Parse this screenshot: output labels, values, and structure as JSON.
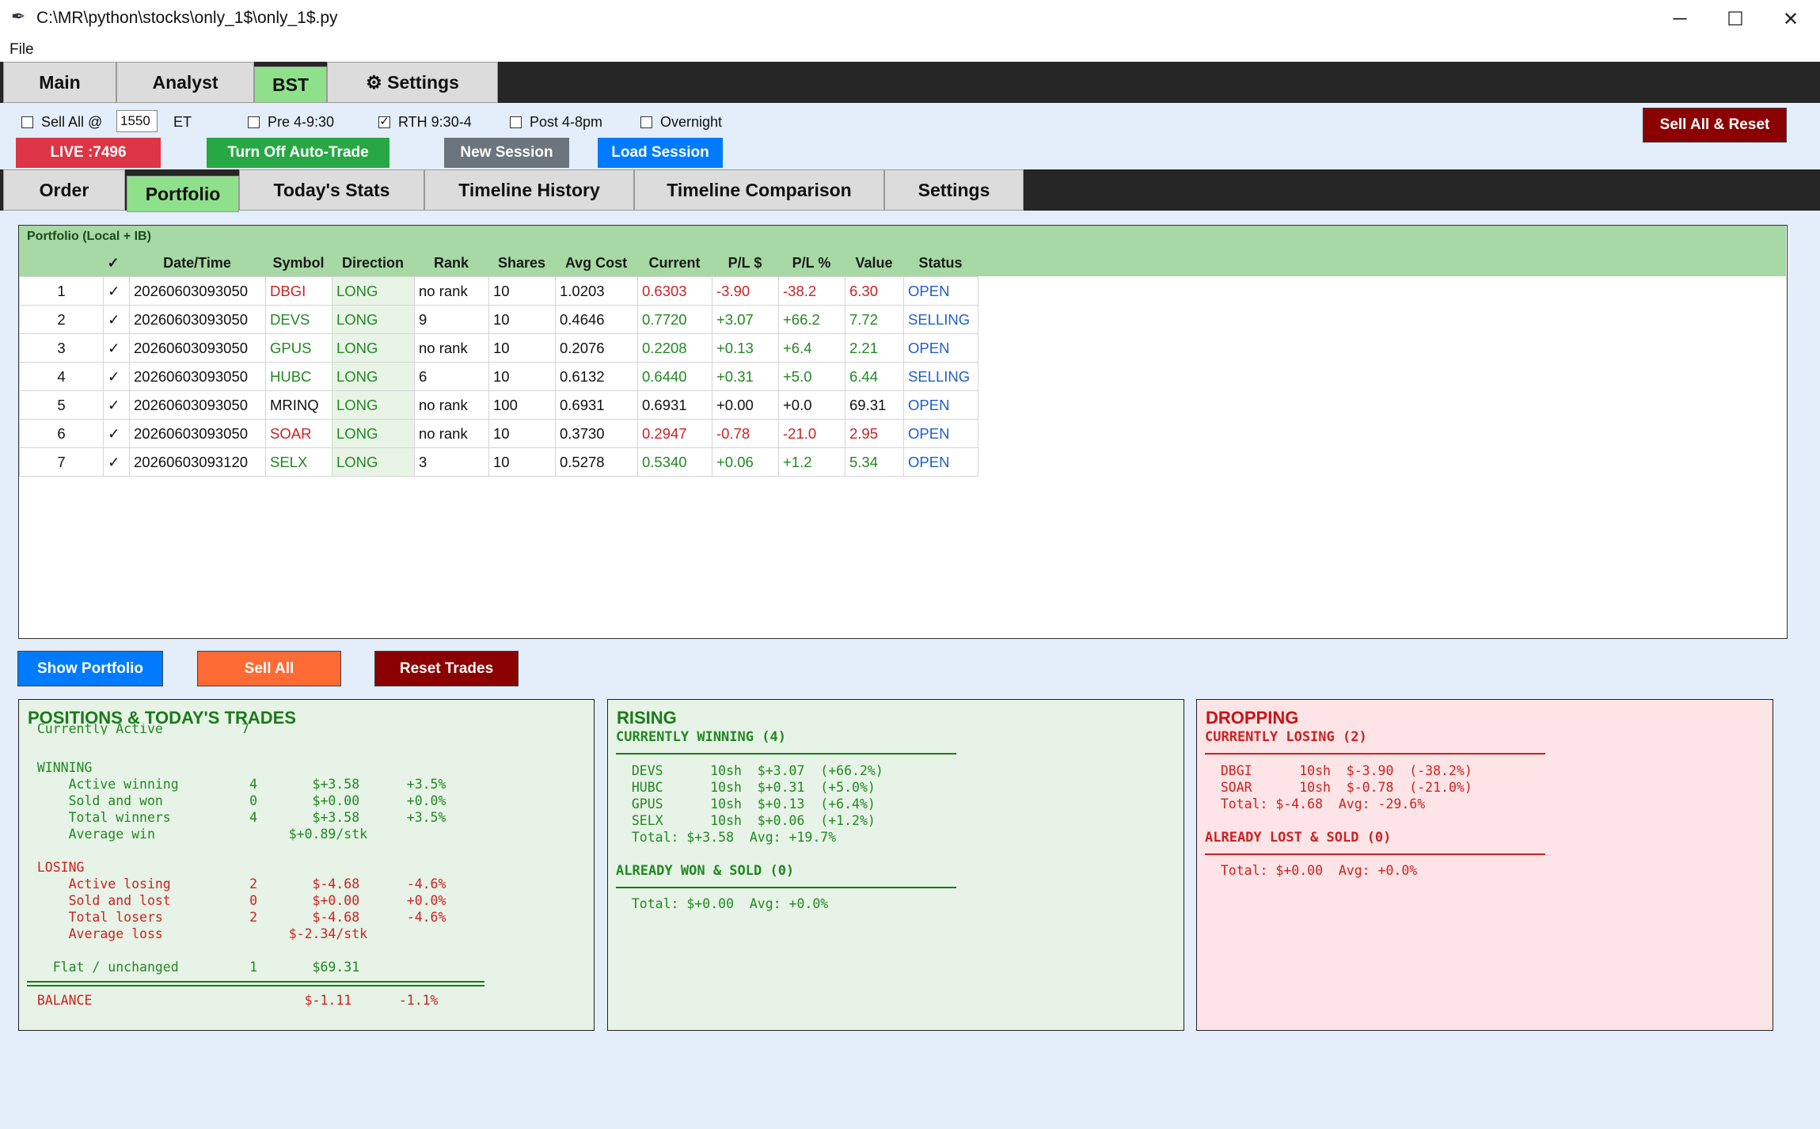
{
  "window": {
    "title": "C:\\MR\\python\\stocks\\only_1$\\only_1$.py"
  },
  "menu": {
    "file": "File"
  },
  "top_tabs": [
    {
      "label": "Main"
    },
    {
      "label": "Analyst"
    },
    {
      "label": "BST"
    },
    {
      "label": "⚙ Settings"
    }
  ],
  "controls": {
    "sell_all_label": "Sell All @",
    "sell_all_time": "1550",
    "sell_all_tz": "ET",
    "pre": "Pre 4-9:30",
    "rth": "RTH 9:30-4",
    "post": "Post 4-8pm",
    "overnight": "Overnight",
    "rth_checked": "✓",
    "live": "LIVE :7496",
    "autotrade": "Turn Off Auto-Trade",
    "new_session": "New Session",
    "load_session": "Load Session",
    "sell_all_reset": "Sell All & Reset"
  },
  "sub_tabs": [
    {
      "label": "Order"
    },
    {
      "label": "Portfolio"
    },
    {
      "label": "Today's Stats"
    },
    {
      "label": "Timeline History"
    },
    {
      "label": "Timeline Comparison"
    },
    {
      "label": "Settings"
    }
  ],
  "portfolio": {
    "caption": "Portfolio (Local + IB)",
    "headers": [
      "✓",
      "Date/Time",
      "Symbol",
      "Direction",
      "Rank",
      "Shares",
      "Avg Cost",
      "Current",
      "P/L $",
      "P/L %",
      "Value",
      "Status"
    ],
    "rows": [
      {
        "n": "1",
        "chk": "✓",
        "dt": "20260603093050",
        "sym": "DBGI",
        "dir": "LONG",
        "rank": "no rank",
        "shares": "10",
        "avg": "1.0203",
        "cur": "0.6303",
        "pl": "-3.90",
        "plp": "-38.2",
        "val": "6.30",
        "status": "OPEN",
        "tone": "r",
        "stat_tone": "b"
      },
      {
        "n": "2",
        "chk": "✓",
        "dt": "20260603093050",
        "sym": "DEVS",
        "dir": "LONG",
        "rank": "9",
        "shares": "10",
        "avg": "0.4646",
        "cur": "0.7720",
        "pl": "+3.07",
        "plp": "+66.2",
        "val": "7.72",
        "status": "SELLING",
        "tone": "g",
        "stat_tone": "b"
      },
      {
        "n": "3",
        "chk": "✓",
        "dt": "20260603093050",
        "sym": "GPUS",
        "dir": "LONG",
        "rank": "no rank",
        "shares": "10",
        "avg": "0.2076",
        "cur": "0.2208",
        "pl": "+0.13",
        "plp": "+6.4",
        "val": "2.21",
        "status": "OPEN",
        "tone": "g",
        "stat_tone": "b"
      },
      {
        "n": "4",
        "chk": "✓",
        "dt": "20260603093050",
        "sym": "HUBC",
        "dir": "LONG",
        "rank": "6",
        "shares": "10",
        "avg": "0.6132",
        "cur": "0.6440",
        "pl": "+0.31",
        "plp": "+5.0",
        "val": "6.44",
        "status": "SELLING",
        "tone": "g",
        "stat_tone": "b"
      },
      {
        "n": "5",
        "chk": "✓",
        "dt": "20260603093050",
        "sym": "MRINQ",
        "dir": "LONG",
        "rank": "no rank",
        "shares": "100",
        "avg": "0.6931",
        "cur": "0.6931",
        "pl": "+0.00",
        "plp": "+0.0",
        "val": "69.31",
        "status": "OPEN",
        "tone": "k",
        "stat_tone": "b"
      },
      {
        "n": "6",
        "chk": "✓",
        "dt": "20260603093050",
        "sym": "SOAR",
        "dir": "LONG",
        "rank": "no rank",
        "shares": "10",
        "avg": "0.3730",
        "cur": "0.2947",
        "pl": "-0.78",
        "plp": "-21.0",
        "val": "2.95",
        "status": "OPEN",
        "tone": "r",
        "stat_tone": "b"
      },
      {
        "n": "7",
        "chk": "✓",
        "dt": "20260603093120",
        "sym": "SELX",
        "dir": "LONG",
        "rank": "3",
        "shares": "10",
        "avg": "0.5278",
        "cur": "0.5340",
        "pl": "+0.06",
        "plp": "+1.2",
        "val": "5.34",
        "status": "OPEN",
        "tone": "g",
        "stat_tone": "b"
      }
    ]
  },
  "actions": {
    "show": "Show Portfolio",
    "sell": "Sell All",
    "reset": "Reset Trades"
  },
  "positions": {
    "title": "POSITIONS & TODAY'S TRADES",
    "active_line": "  Currently Active          7",
    "winning": "  WINNING",
    "win_lines": [
      "      Active winning         4       $+3.58      +3.5%",
      "      Sold and won           0       $+0.00      +0.0%",
      "      Total winners          4       $+3.58      +3.5%",
      "      Average win                 $+0.89/stk"
    ],
    "losing": "  LOSING",
    "lose_lines": [
      "      Active losing          2       $-4.68      -4.6%",
      "      Sold and lost          0       $+0.00      +0.0%",
      "      Total losers           2       $-4.68      -4.6%",
      "      Average loss                $-2.34/stk"
    ],
    "flat": "    Flat / unchanged         1       $69.31",
    "balance": "  BALANCE                           $-1.11      -1.1%"
  },
  "rising": {
    "title": "RISING",
    "sub1": "CURRENTLY WINNING (4)",
    "lines": [
      "  DEVS      10sh  $+3.07  (+66.2%)",
      "  HUBC      10sh  $+0.31  (+5.0%)",
      "  GPUS      10sh  $+0.13  (+6.4%)",
      "  SELX      10sh  $+0.06  (+1.2%)",
      "  Total: $+3.58  Avg: +19.7%"
    ],
    "sub2": "ALREADY WON & SOLD (0)",
    "total2": "  Total: $+0.00  Avg: +0.0%"
  },
  "dropping": {
    "title": "DROPPING",
    "sub1": "CURRENTLY LOSING (2)",
    "lines": [
      "  DBGI      10sh  $-3.90  (-38.2%)",
      "  SOAR      10sh  $-0.78  (-21.0%)",
      "  Total: $-4.68  Avg: -29.6%"
    ],
    "sub2": "ALREADY LOST & SOLD (0)",
    "total2": "  Total: $+0.00  Avg: +0.0%"
  },
  "colors": {
    "green": "#228822",
    "red": "#cc2222",
    "blue": "#1f5fc8",
    "tab_active": "#8fe08a"
  }
}
